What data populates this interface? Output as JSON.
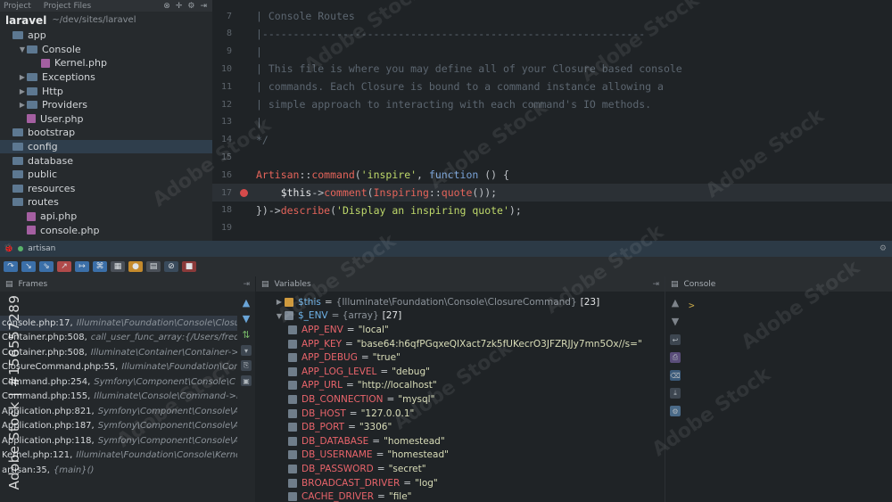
{
  "project": {
    "tabs": [
      "Project",
      "Project Files"
    ],
    "root_name": "laravel",
    "root_path": "~/dev/sites/laravel",
    "items": [
      {
        "label": "app",
        "kind": "folder",
        "depth": 0,
        "arrow": ""
      },
      {
        "label": "Console",
        "kind": "folder",
        "depth": 1,
        "arrow": "▼"
      },
      {
        "label": "Kernel.php",
        "kind": "php",
        "depth": 2,
        "arrow": ""
      },
      {
        "label": "Exceptions",
        "kind": "folder",
        "depth": 1,
        "arrow": "▶"
      },
      {
        "label": "Http",
        "kind": "folder",
        "depth": 1,
        "arrow": "▶"
      },
      {
        "label": "Providers",
        "kind": "folder",
        "depth": 1,
        "arrow": "▶"
      },
      {
        "label": "User.php",
        "kind": "php",
        "depth": 1,
        "arrow": ""
      },
      {
        "label": "bootstrap",
        "kind": "folder",
        "depth": 0,
        "arrow": ""
      },
      {
        "label": "config",
        "kind": "folder",
        "depth": 0,
        "arrow": "",
        "selected": true
      },
      {
        "label": "database",
        "kind": "folder",
        "depth": 0,
        "arrow": ""
      },
      {
        "label": "public",
        "kind": "folder",
        "depth": 0,
        "arrow": ""
      },
      {
        "label": "resources",
        "kind": "folder",
        "depth": 0,
        "arrow": ""
      },
      {
        "label": "routes",
        "kind": "folder",
        "depth": 0,
        "arrow": ""
      },
      {
        "label": "api.php",
        "kind": "php",
        "depth": 1,
        "arrow": ""
      },
      {
        "label": "console.php",
        "kind": "php",
        "depth": 1,
        "arrow": ""
      }
    ]
  },
  "editor": {
    "lines": [
      {
        "num": "7",
        "tokens": [
          [
            "c-comment",
            "| Console Routes"
          ]
        ]
      },
      {
        "num": "8",
        "tokens": [
          [
            "c-comment",
            "|--------------------------------------------------------------"
          ]
        ]
      },
      {
        "num": "9",
        "tokens": [
          [
            "c-comment",
            "|"
          ]
        ]
      },
      {
        "num": "10",
        "tokens": [
          [
            "c-comment",
            "| This file is where you may define all of your Closure based console"
          ]
        ]
      },
      {
        "num": "11",
        "tokens": [
          [
            "c-comment",
            "| commands. Each Closure is bound to a command instance allowing a"
          ]
        ]
      },
      {
        "num": "12",
        "tokens": [
          [
            "c-comment",
            "| simple approach to interacting with each command's IO methods."
          ]
        ]
      },
      {
        "num": "13",
        "tokens": [
          [
            "c-comment",
            "|"
          ]
        ]
      },
      {
        "num": "14",
        "tokens": [
          [
            "c-comment",
            "*/"
          ]
        ]
      },
      {
        "num": "15",
        "tokens": []
      },
      {
        "num": "16",
        "tokens": [
          [
            "c-class",
            "Artisan"
          ],
          [
            "c-op",
            "::"
          ],
          [
            "c-method",
            "command"
          ],
          [
            "c-op",
            "("
          ],
          [
            "c-str",
            "'inspire'"
          ],
          [
            "c-op",
            ", "
          ],
          [
            "c-kw",
            "function"
          ],
          [
            "c-op",
            " () {"
          ]
        ]
      },
      {
        "num": "17",
        "breakpoint": true,
        "current": true,
        "tokens": [
          [
            "c-op",
            "    "
          ],
          [
            "c-var",
            "$this"
          ],
          [
            "c-op",
            "->"
          ],
          [
            "c-method",
            "comment"
          ],
          [
            "c-op",
            "("
          ],
          [
            "c-class",
            "Inspiring"
          ],
          [
            "c-op",
            "::"
          ],
          [
            "c-method",
            "quote"
          ],
          [
            "c-op",
            "());"
          ]
        ]
      },
      {
        "num": "18",
        "tokens": [
          [
            "c-op",
            "})->"
          ],
          [
            "c-method",
            "describe"
          ],
          [
            "c-op",
            "("
          ],
          [
            "c-str",
            "'Display an inspiring quote'"
          ],
          [
            "c-op",
            ");"
          ]
        ]
      },
      {
        "num": "19",
        "tokens": []
      }
    ]
  },
  "debug": {
    "title": "artisan"
  },
  "frames": {
    "header": "Frames",
    "rows": [
      {
        "file": "console.php:17,",
        "detail": "Illuminate\\Foundation\\Console\\Closu",
        "selected": true
      },
      {
        "file": "Container.php:508,",
        "detail": "call_user_func_array:{/Users/fred"
      },
      {
        "file": "Container.php:508,",
        "detail": "Illuminate\\Container\\Container->"
      },
      {
        "file": "ClosureCommand.php:55,",
        "detail": "Illuminate\\Foundation\\Console\\"
      },
      {
        "file": "Command.php:254,",
        "detail": "Symfony\\Component\\Console\\C"
      },
      {
        "file": "Command.php:155,",
        "detail": "Illuminate\\Console\\Command->r"
      },
      {
        "file": "Application.php:821,",
        "detail": "Symfony\\Component\\Console\\A"
      },
      {
        "file": "Application.php:187,",
        "detail": "Symfony\\Component\\Console\\A"
      },
      {
        "file": "Application.php:118,",
        "detail": "Symfony\\Component\\Console\\A"
      },
      {
        "file": "Kernel.php:121,",
        "detail": "Illuminate\\Foundation\\Console\\Kerne"
      },
      {
        "file": "artisan:35,",
        "detail": "{main}()"
      }
    ]
  },
  "variables": {
    "header": "Variables",
    "this": {
      "name": "$this",
      "type": "{Illuminate\\Foundation\\Console\\ClosureCommand}",
      "count": "[23]"
    },
    "env": {
      "name": "$_ENV",
      "type": "= {array}",
      "count": "[27]"
    },
    "items": [
      {
        "name": "APP_ENV",
        "value": "\"local\""
      },
      {
        "name": "APP_KEY",
        "value": "\"base64:h6qfPGqxeQIXact7zk5fUKecrO3JFZRJJy7mn5Ox//s=\""
      },
      {
        "name": "APP_DEBUG",
        "value": "\"true\""
      },
      {
        "name": "APP_LOG_LEVEL",
        "value": "\"debug\""
      },
      {
        "name": "APP_URL",
        "value": "\"http://localhost\""
      },
      {
        "name": "DB_CONNECTION",
        "value": "\"mysql\""
      },
      {
        "name": "DB_HOST",
        "value": "\"127.0.0.1\""
      },
      {
        "name": "DB_PORT",
        "value": "\"3306\""
      },
      {
        "name": "DB_DATABASE",
        "value": "\"homestead\""
      },
      {
        "name": "DB_USERNAME",
        "value": "\"homestead\""
      },
      {
        "name": "DB_PASSWORD",
        "value": "\"secret\""
      },
      {
        "name": "BROADCAST_DRIVER",
        "value": "\"log\""
      },
      {
        "name": "CACHE_DRIVER",
        "value": "\"file\""
      }
    ]
  },
  "console": {
    "header": "Console",
    "prompt": ">"
  },
  "watermark": {
    "side_text": "Adobe Stock | #156557289",
    "text": "Adobe Stock"
  }
}
